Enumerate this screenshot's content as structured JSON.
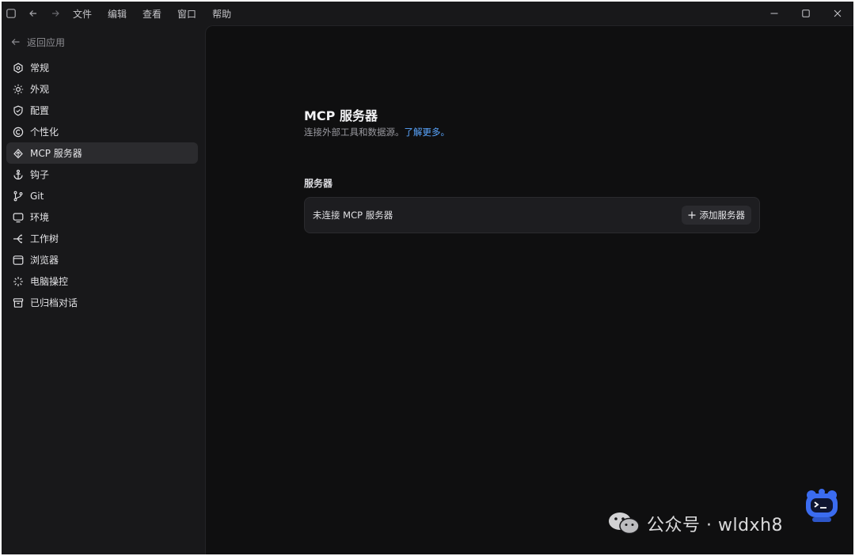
{
  "menubar": {
    "items": [
      "文件",
      "编辑",
      "查看",
      "窗口",
      "帮助"
    ]
  },
  "sidebar": {
    "back_label": "返回应用",
    "items": [
      {
        "label": "常规",
        "icon": "settings-icon"
      },
      {
        "label": "外观",
        "icon": "sun-icon"
      },
      {
        "label": "配置",
        "icon": "shield-icon"
      },
      {
        "label": "个性化",
        "icon": "personalize-icon"
      },
      {
        "label": "MCP 服务器",
        "icon": "mcp-icon",
        "active": true
      },
      {
        "label": "钩子",
        "icon": "anchor-icon"
      },
      {
        "label": "Git",
        "icon": "git-branch-icon"
      },
      {
        "label": "环境",
        "icon": "monitor-icon"
      },
      {
        "label": "工作树",
        "icon": "worktree-icon"
      },
      {
        "label": "浏览器",
        "icon": "browser-icon"
      },
      {
        "label": "电脑操控",
        "icon": "sparkle-icon"
      },
      {
        "label": "已归档对话",
        "icon": "archive-icon"
      }
    ]
  },
  "main": {
    "title": "MCP 服务器",
    "subtitle": "连接外部工具和数据源。",
    "learn_more": "了解更多。",
    "section_label": "服务器",
    "empty_text": "未连接 MCP 服务器",
    "add_button": "添加服务器"
  },
  "watermark": {
    "text": "公众号 · wldxh8"
  },
  "colors": {
    "accent_link": "#5aa6ff",
    "sidebar_bg": "#18181a",
    "main_bg": "#0f0f10",
    "card_bg": "#1d1d20"
  }
}
